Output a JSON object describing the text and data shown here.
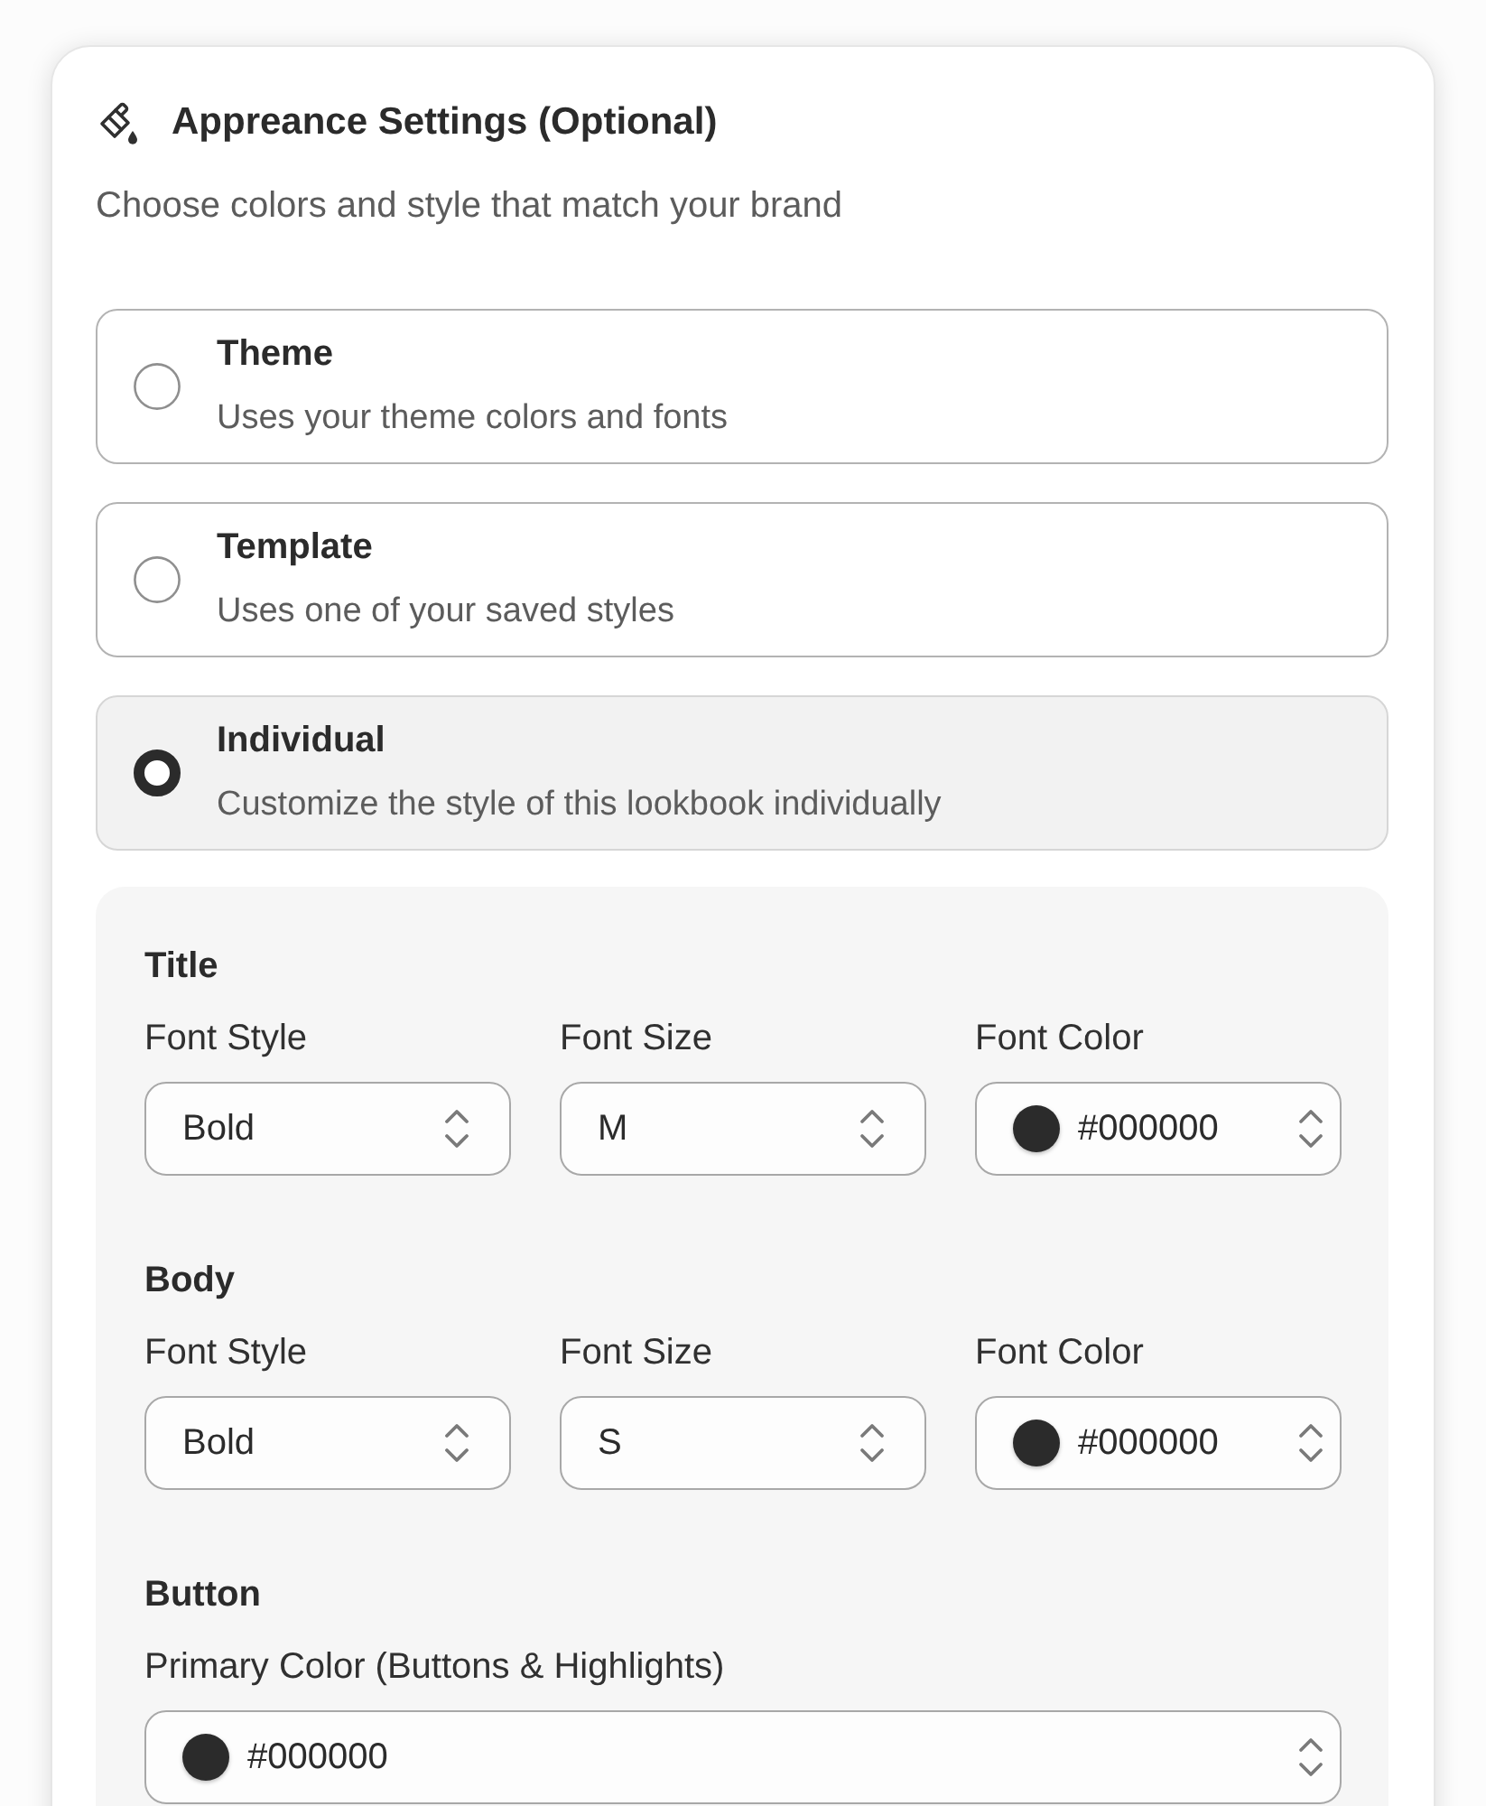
{
  "header": {
    "title": "Appreance Settings (Optional)",
    "subtitle": "Choose colors and style that match your brand"
  },
  "options": [
    {
      "title": "Theme",
      "description": "Uses your theme colors and fonts",
      "selected": false
    },
    {
      "title": "Template",
      "description": "Uses one of your saved styles",
      "selected": false
    },
    {
      "title": "Individual",
      "description": "Customize the style of this lookbook individually",
      "selected": true
    }
  ],
  "sections": [
    {
      "title": "Title",
      "fields": [
        {
          "kind": "select",
          "label": "Font Style",
          "value": "Bold"
        },
        {
          "kind": "select",
          "label": "Font Size",
          "value": "M"
        },
        {
          "kind": "color",
          "label": "Font Color",
          "value": "#000000",
          "color": "#2b2b2b"
        }
      ]
    },
    {
      "title": "Body",
      "fields": [
        {
          "kind": "select",
          "label": "Font Style",
          "value": "Bold"
        },
        {
          "kind": "select",
          "label": "Font Size",
          "value": "S"
        },
        {
          "kind": "color",
          "label": "Font Color",
          "value": "#000000",
          "color": "#2b2b2b"
        }
      ]
    },
    {
      "title": "Button",
      "fields": [
        {
          "kind": "color",
          "label": "Primary Color (Buttons & Highlights)",
          "value": "#000000",
          "color": "#2b2b2b"
        }
      ]
    }
  ]
}
